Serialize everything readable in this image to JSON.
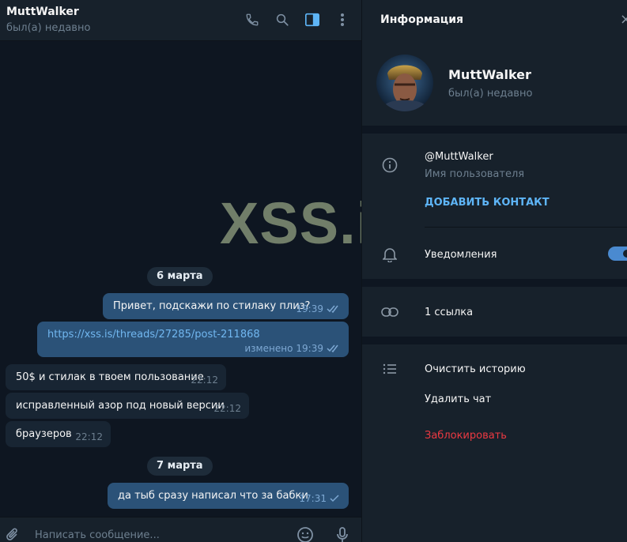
{
  "chat": {
    "title": "MuttWalker",
    "status": "был(а) недавно",
    "header_icons": [
      "phone-icon",
      "search-icon",
      "sidebar-panel-icon",
      "more-vertical-icon"
    ],
    "dates": [
      "6 марта",
      "7 марта"
    ],
    "messages": [
      {
        "dir": "out",
        "text": "Привет, подскажи по стилаку плиз?",
        "time": "19:39",
        "check": "double"
      },
      {
        "dir": "out",
        "text": "https://xss.is/threads/27285/post-211868",
        "edited": "изменено",
        "time": "19:39",
        "check": "double",
        "link": true
      },
      {
        "dir": "in",
        "text": "50$ и стилак в твоем пользование",
        "time": "22:12"
      },
      {
        "dir": "in",
        "text": "исправленный азор под новый версии",
        "time": "22:12"
      },
      {
        "dir": "in",
        "text": "браузеров",
        "time": "22:12"
      },
      {
        "dir": "out",
        "text": "да тыб сразу написал что за бабки",
        "time": "17:31",
        "check": "single"
      }
    ],
    "composer_placeholder": "Написать сообщение...",
    "watermark": "XSS.is"
  },
  "info": {
    "title": "Информация",
    "close": "×",
    "name": "MuttWalker",
    "status": "был(а) недавно",
    "username": "@MuttWalker",
    "username_label": "Имя пользователя",
    "add_contact": "ДОБАВИТЬ КОНТАКТ",
    "notifications": "Уведомления",
    "notifications_on": true,
    "links": "1 ссылка",
    "clear_history": "Очистить историю",
    "delete_chat": "Удалить чат",
    "block": "Заблокировать"
  },
  "colors": {
    "background": "#0e1621",
    "panel": "#17212b",
    "bubble_out": "#2b5278",
    "bubble_in": "#182533",
    "accent": "#5eb5f7",
    "danger": "#ec3942",
    "link": "#71b7f0"
  }
}
